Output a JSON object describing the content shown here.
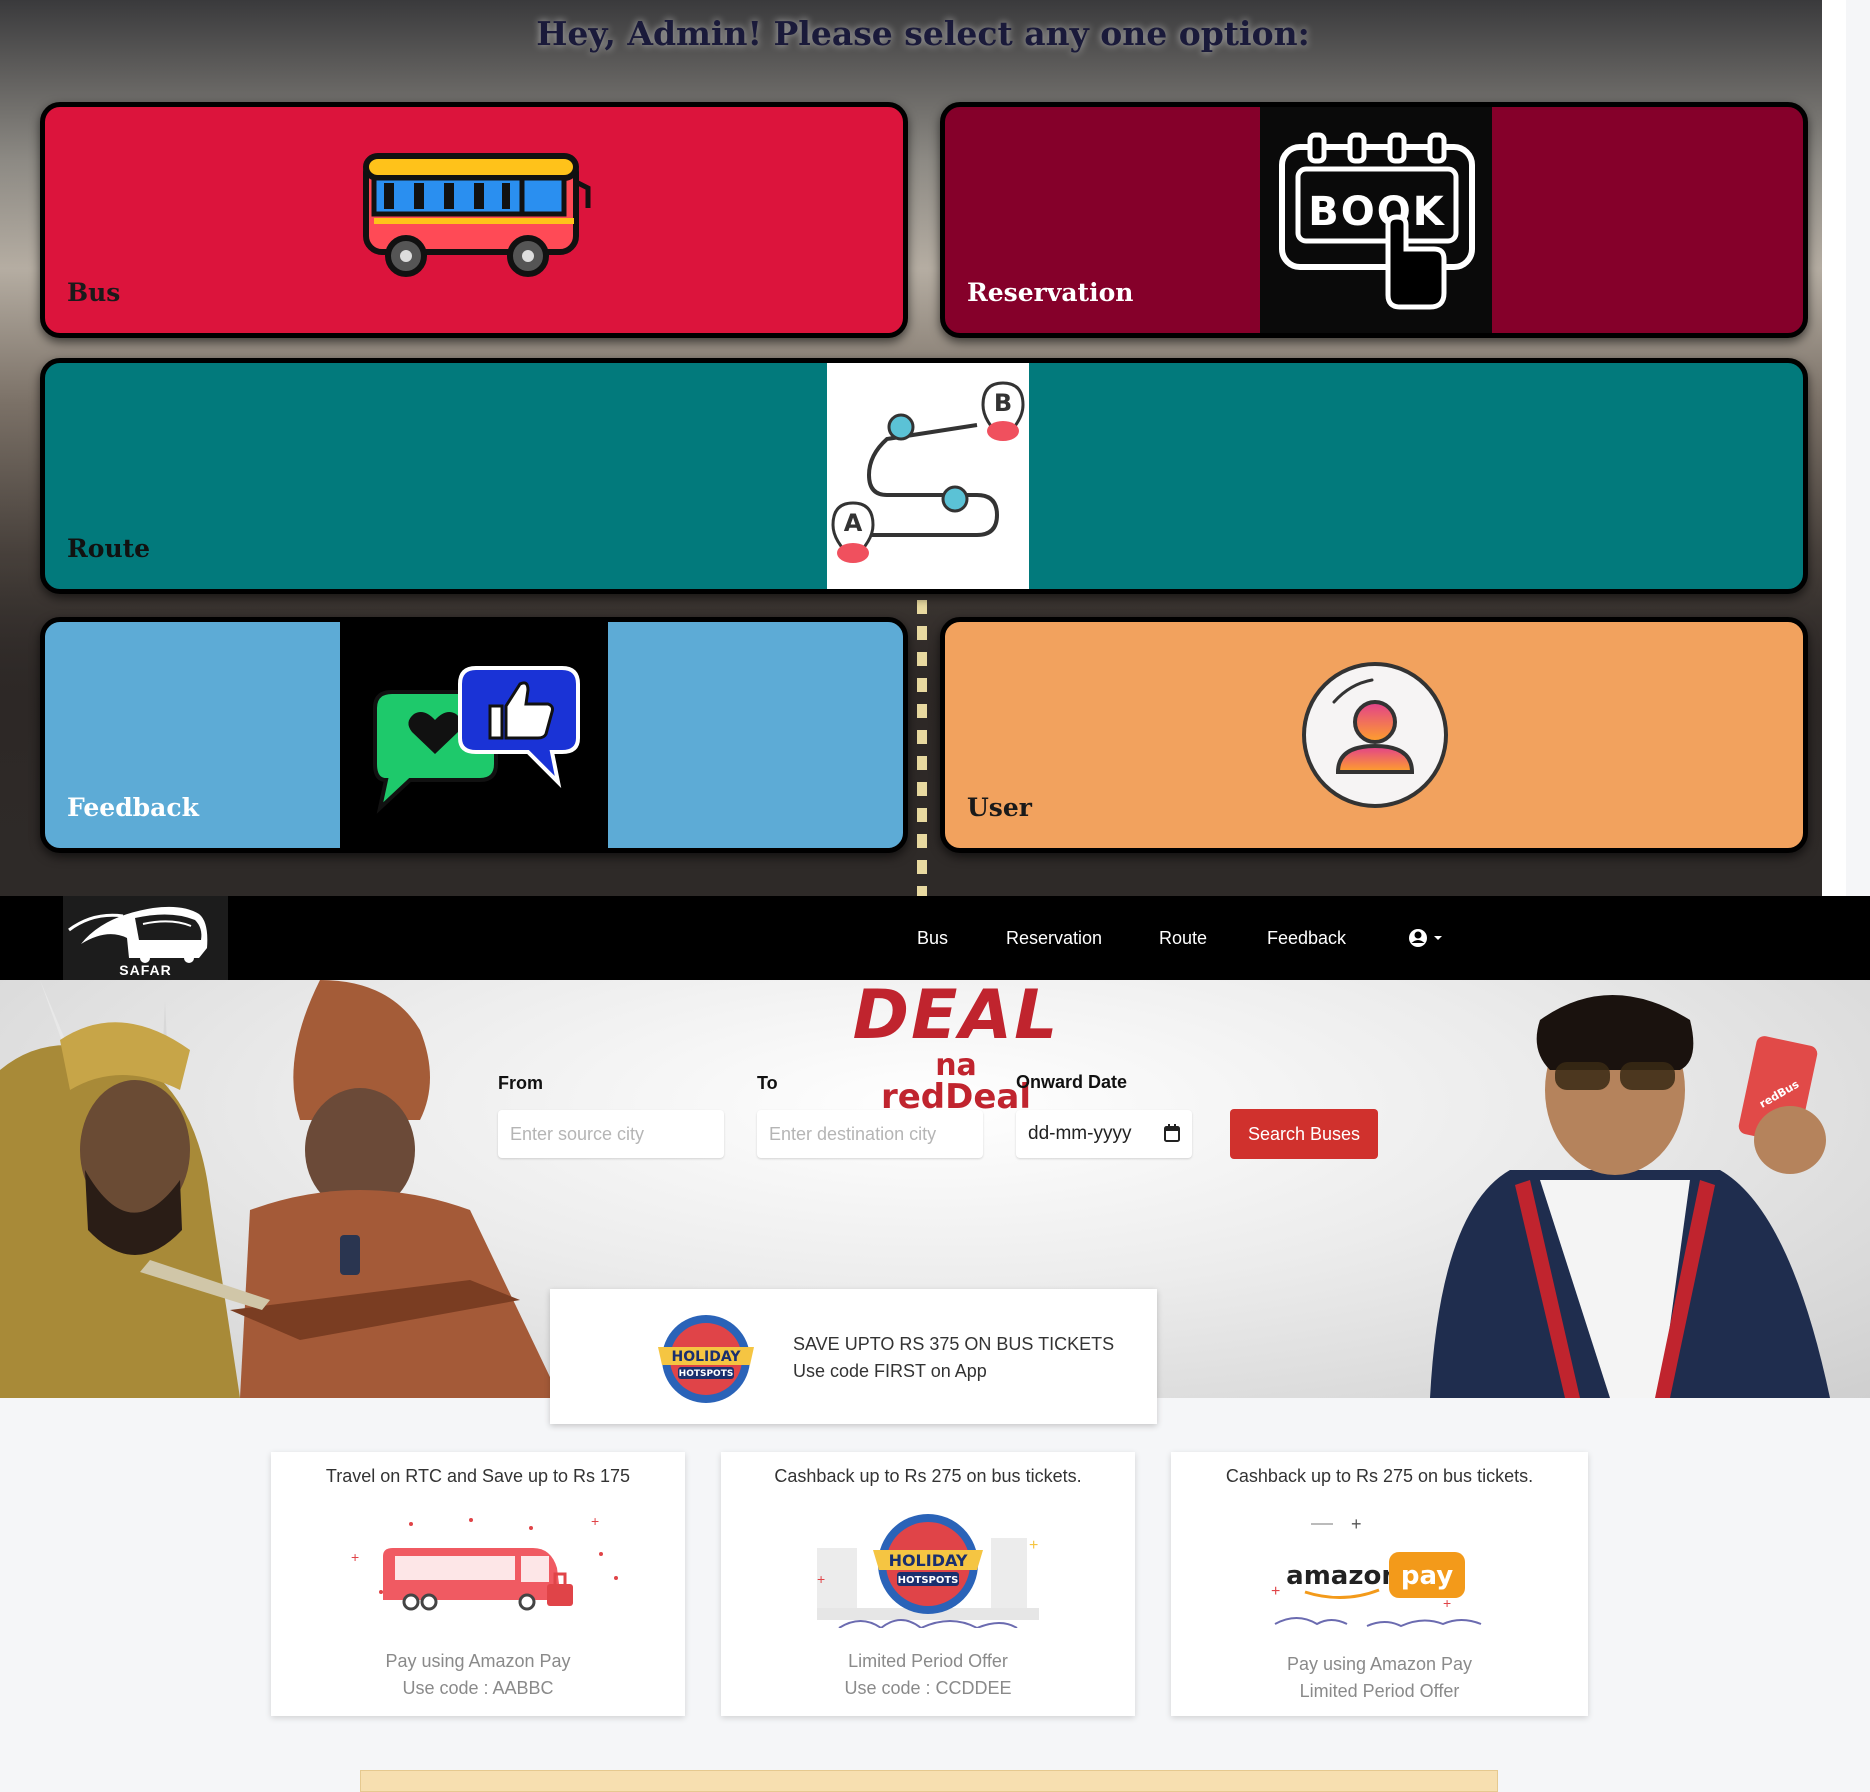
{
  "admin": {
    "title": "Hey, Admin! Please select any one option:",
    "tiles": {
      "bus": "Bus",
      "reservation": "Reservation",
      "route": "Route",
      "feedback": "Feedback",
      "user": "User"
    },
    "book_icon_text": "BOOK",
    "route_marker_a": "A",
    "route_marker_b": "B",
    "colors": {
      "bus": "#dc143c",
      "reservation": "#85002a",
      "route": "#027a7c",
      "feedback": "#5dabd6",
      "user": "#f2a25e"
    }
  },
  "navbar": {
    "logo_text": "SAFAR",
    "items": [
      "Bus",
      "Reservation",
      "Route",
      "Feedback"
    ],
    "user_menu_icon": "user-circle-icon"
  },
  "hero": {
    "deal_line1": "DEAL",
    "deal_line2": "na",
    "deal_line3": "redDeal",
    "from_label": "From",
    "from_placeholder": "Enter source city",
    "to_label": "To",
    "to_placeholder": "Enter destination city",
    "date_label": "Onward Date",
    "date_value": "dd-mm-yyyy",
    "search_label": "Search Buses",
    "phone_brand": "redBus"
  },
  "promo": {
    "badge_line1": "HOLIDAY",
    "badge_line2": "HOTSPOTS",
    "line1": "SAVE UPTO RS 375 ON BUS TICKETS",
    "line2": "Use code FIRST on App"
  },
  "offers": [
    {
      "title": "Travel on RTC and Save up to Rs 175",
      "line1": "Pay using Amazon Pay",
      "line2": "Use code : AABBC"
    },
    {
      "title": "Cashback up to Rs 275 on bus tickets.",
      "line1": "Limited Period Offer",
      "line2": "Use code : CCDDEE",
      "badge_line1": "HOLIDAY",
      "badge_line2": "HOTSPOTS"
    },
    {
      "title": "Cashback up to Rs 275 on bus tickets.",
      "line1": "Pay using Amazon Pay",
      "line2": "Limited Period Offer",
      "brand1": "amazon",
      "brand2": "pay"
    }
  ]
}
